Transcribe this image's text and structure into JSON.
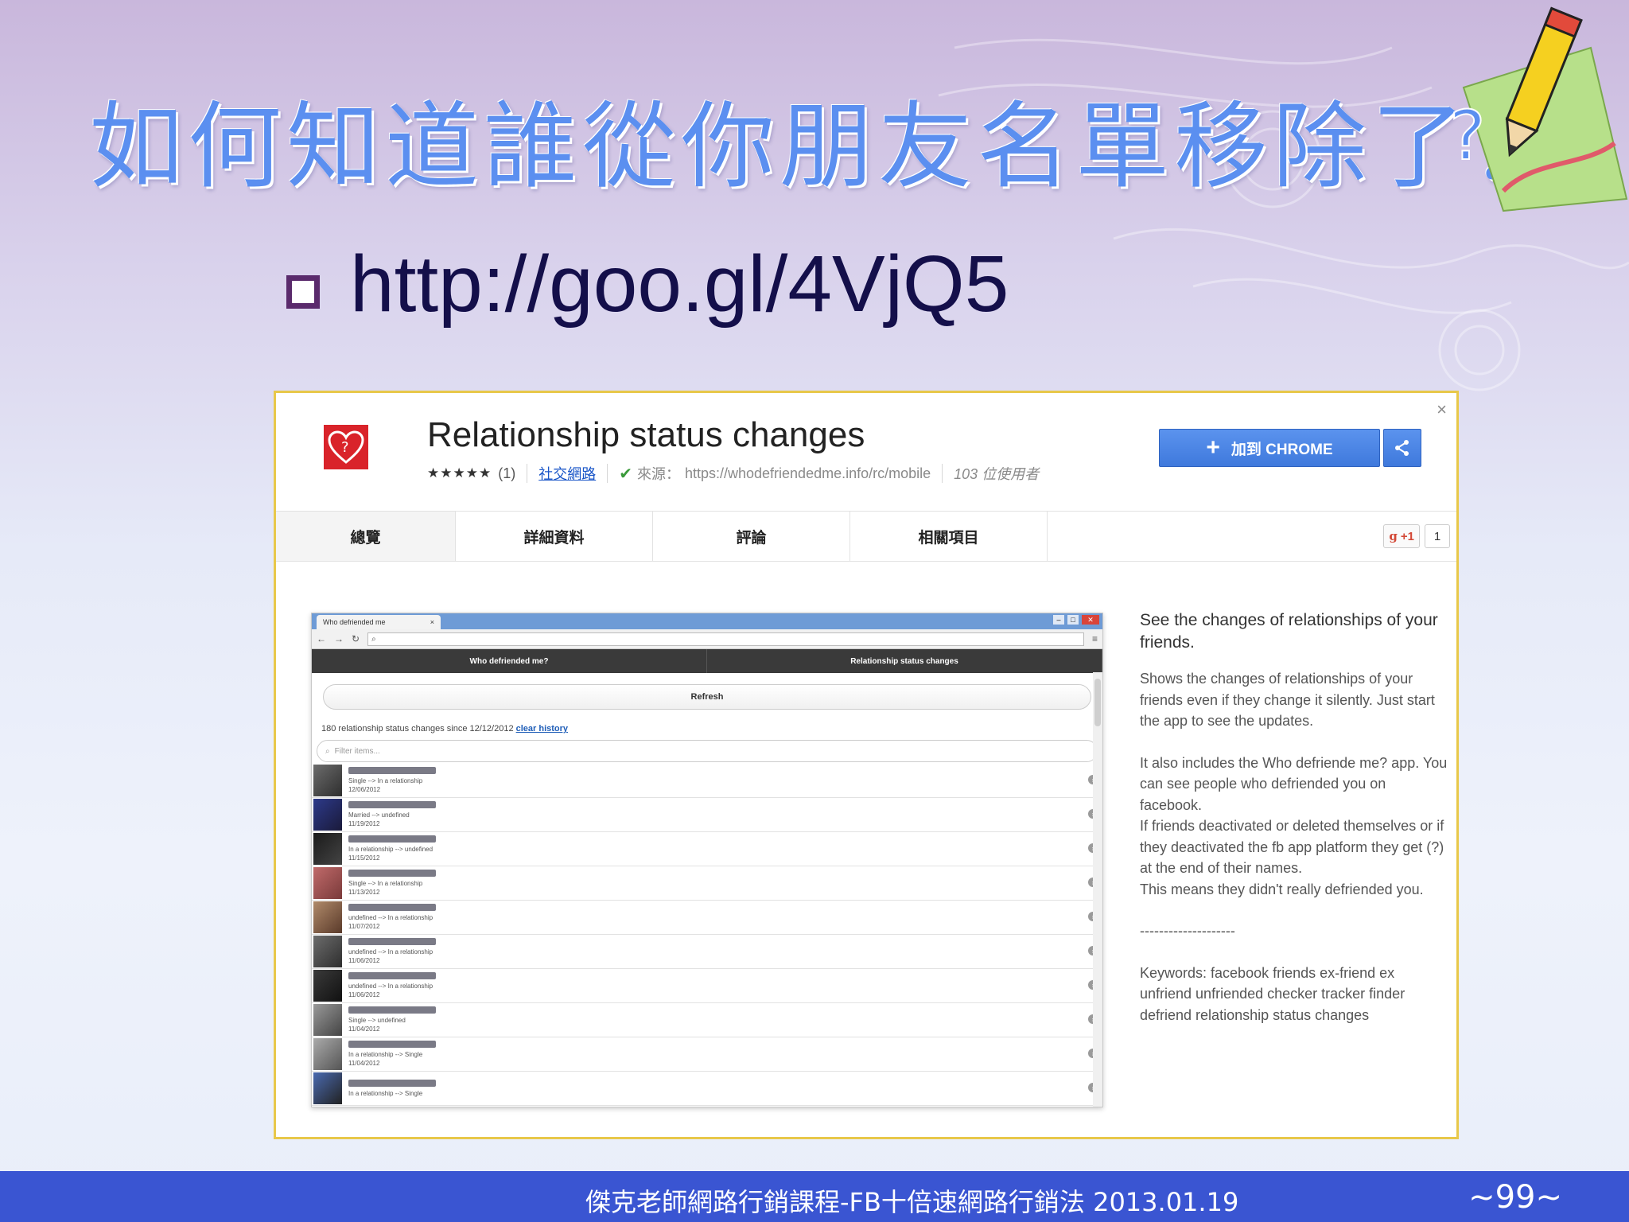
{
  "slide": {
    "title": "如何知道誰從你朋友名單移除了？",
    "bullet": "http://goo.gl/4VjQ5",
    "footer": "傑克老師網路行銷課程-FB十倍速網路行銷法 2013.01.19",
    "page_number": "~99~"
  },
  "store": {
    "close_label": "×",
    "app_name": "Relationship status changes",
    "stars": "★★★★★",
    "rating_count": "(1)",
    "category": "社交網路",
    "source": "來源：",
    "source_url": "https://whodefriendedme.info/rc/mobile",
    "users": "103 位使用者",
    "add_button": "加到 CHROME",
    "tabs": [
      "總覽",
      "詳細資料",
      "評論",
      "相關項目"
    ],
    "gplus_label": "+1",
    "gplus_count": "1"
  },
  "inner_browser": {
    "tab_title": "Who defriended me",
    "tab_close": "×",
    "nav": [
      "Who defriended me?",
      "Relationship status changes"
    ],
    "refresh": "Refresh",
    "status_text": "180 relationship status changes since 12/12/2012",
    "clear_history": "clear history",
    "filter_placeholder": "Filter items...",
    "rows": [
      {
        "change": "Single --> In a relationship",
        "date": "12/06/2012"
      },
      {
        "change": "Married --> undefined",
        "date": "11/19/2012"
      },
      {
        "change": "In a relationship --> undefined",
        "date": "11/15/2012"
      },
      {
        "change": "Single --> In a relationship",
        "date": "11/13/2012"
      },
      {
        "change": "undefined --> In a relationship",
        "date": "11/07/2012"
      },
      {
        "change": "undefined --> In a relationship",
        "date": "11/06/2012"
      },
      {
        "change": "undefined --> In a relationship",
        "date": "11/06/2012"
      },
      {
        "change": "Single --> undefined",
        "date": "11/04/2012"
      },
      {
        "change": "In a relationship --> Single",
        "date": "11/04/2012"
      },
      {
        "change": "In a relationship --> Single",
        "date": ""
      }
    ]
  },
  "description": {
    "heading": "See the changes of relationships of your friends.",
    "p1": "Shows the changes of relationships of your friends even if they change it silently. Just start the app to see the updates.",
    "p2": "It also includes the Who defriende me? app. You can see people who defriended you on facebook.",
    "p3": "If friends deactivated or deleted themselves or if they deactivated the fb app platform they get (?) at the end of their names.",
    "p4": "This means they didn't really defriended you.",
    "divider": "--------------------",
    "keywords": "Keywords: facebook friends ex-friend ex unfriend unfriended checker tracker finder defriend relationship status changes"
  },
  "colors": {
    "title": "#5b8ff0",
    "footer_bar": "#3a55d2",
    "add_button": "#4a86e8",
    "store_border": "#e8c84a"
  }
}
